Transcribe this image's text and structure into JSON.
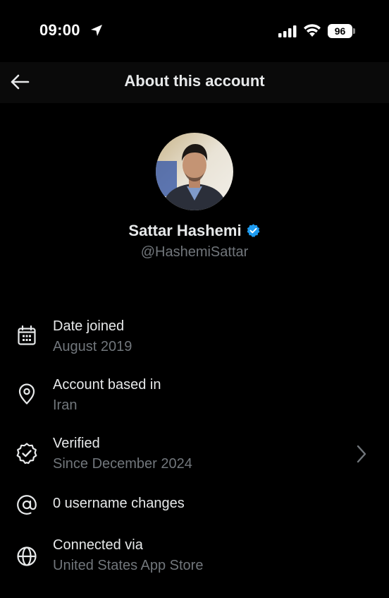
{
  "status_bar": {
    "time": "09:00",
    "battery_level": "96"
  },
  "header": {
    "title": "About this account"
  },
  "profile": {
    "name": "Sattar Hashemi",
    "handle": "@HashemiSattar",
    "verified_badge_color": "#1d9bf0"
  },
  "details": [
    {
      "icon": "calendar-icon",
      "title": "Date joined",
      "subtitle": "August 2019"
    },
    {
      "icon": "location-pin-icon",
      "title": "Account based in",
      "subtitle": "Iran"
    },
    {
      "icon": "verified-badge-icon",
      "title": "Verified",
      "subtitle": "Since December 2024"
    },
    {
      "icon": "at-sign-icon",
      "title": "0 username changes",
      "subtitle": ""
    },
    {
      "icon": "globe-icon",
      "title": "Connected via",
      "subtitle": "United States App Store"
    }
  ],
  "colors": {
    "background": "#000000",
    "primary_text": "#e7e9ea",
    "secondary_text": "#71767b",
    "accent": "#1d9bf0"
  }
}
